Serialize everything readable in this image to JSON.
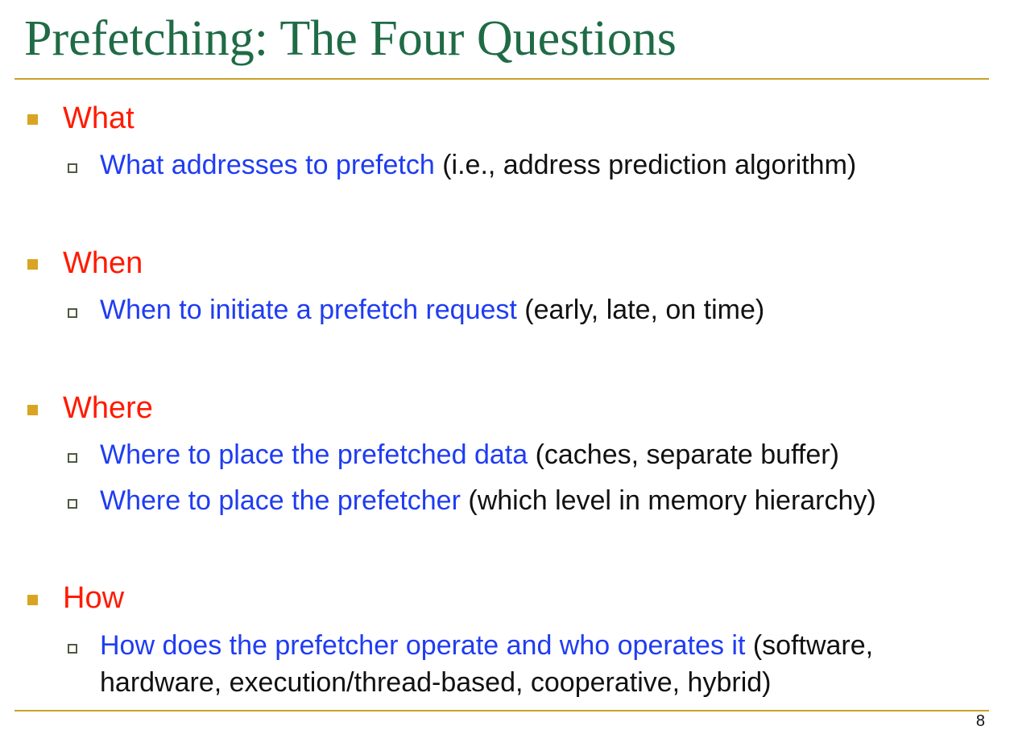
{
  "slide": {
    "title": "Prefetching: The Four Questions",
    "page_number": "8",
    "colors": {
      "title": "#1f6b45",
      "rule": "#c9a227",
      "main_label": "#ff1a00",
      "highlight": "#1f3cf2",
      "body_text": "#111111",
      "main_bullet": "#d9a521"
    }
  },
  "sections": [
    {
      "label": "What",
      "items": [
        {
          "highlight": "What addresses to prefetch",
          "rest": " (i.e., address prediction algorithm)"
        }
      ]
    },
    {
      "label": "When",
      "items": [
        {
          "highlight": "When to initiate a prefetch request",
          "rest": " (early, late, on time)"
        }
      ]
    },
    {
      "label": "Where",
      "items": [
        {
          "highlight": "Where to place the prefetched data",
          "rest": " (caches, separate buffer)"
        },
        {
          "highlight": "Where to place the prefetcher",
          "rest": " (which level in memory hierarchy)"
        }
      ]
    },
    {
      "label": "How",
      "items": [
        {
          "highlight": "How does the prefetcher operate and who operates it",
          "rest": " (software, hardware, execution/thread-based, cooperative, hybrid)"
        }
      ]
    }
  ]
}
